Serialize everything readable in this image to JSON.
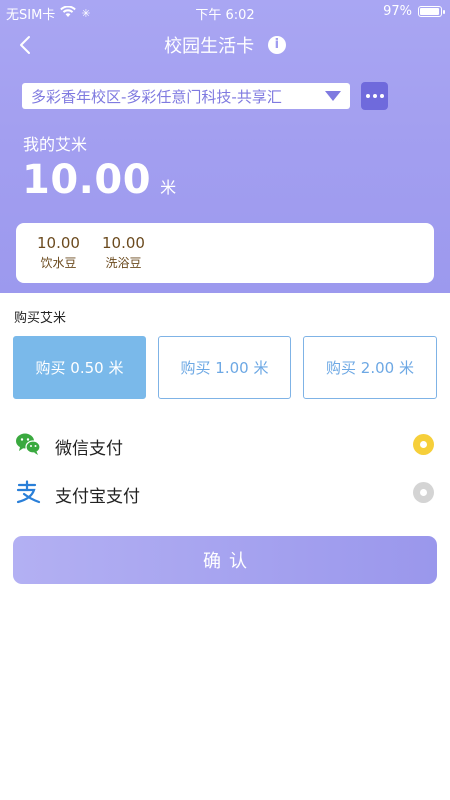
{
  "status_bar": {
    "carrier": "无SIM卡",
    "time": "下午 6:02",
    "battery_percent": "97%",
    "battery_level": 0.97
  },
  "nav": {
    "title": "校园生活卡",
    "info_icon": "i"
  },
  "campus_selector": {
    "value": "多彩香年校区-多彩任意门科技-共享汇"
  },
  "balance": {
    "label": "我的艾米",
    "value": "10.00",
    "unit": "米"
  },
  "beans": [
    {
      "value": "10.00",
      "label": "饮水豆"
    },
    {
      "value": "10.00",
      "label": "洗浴豆"
    }
  ],
  "purchase": {
    "title": "购买艾米",
    "options": [
      {
        "label": "购买 0.50 米",
        "selected": true
      },
      {
        "label": "购买 1.00 米",
        "selected": false
      },
      {
        "label": "购买 2.00 米",
        "selected": false
      }
    ]
  },
  "payment": [
    {
      "label": "微信支付",
      "icon": "wechat-icon",
      "selected": true,
      "color": "#3aa93f"
    },
    {
      "label": "支付宝支付",
      "icon": "alipay-icon",
      "selected": false,
      "color": "#2a7fd8"
    }
  ],
  "confirm_label": "确认",
  "colors": {
    "header": "#a39ff0",
    "accent": "#7f7ae0",
    "selected_amount": "#7ab9ea",
    "radio_on": "#f6cf3a"
  }
}
